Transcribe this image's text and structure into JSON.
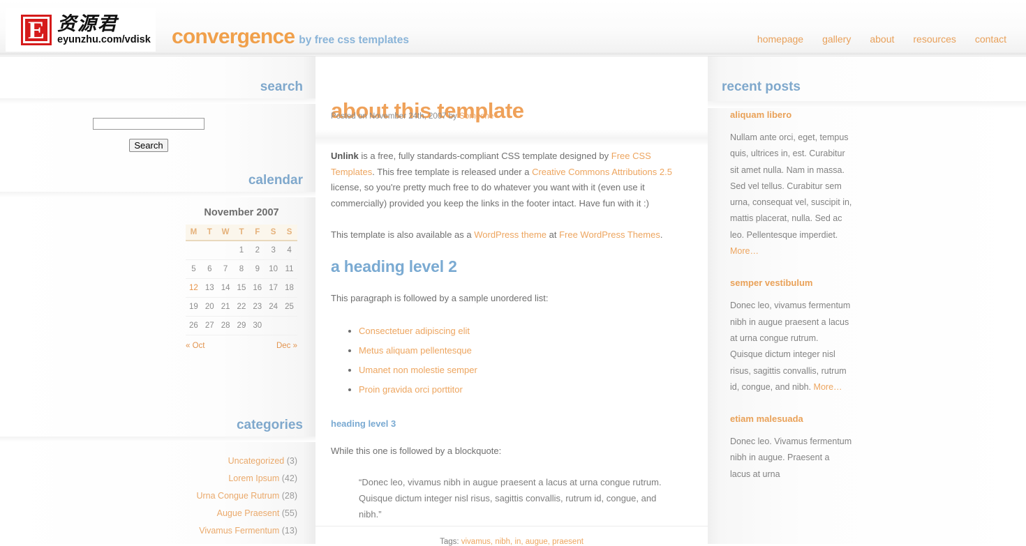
{
  "header": {
    "logo": {
      "badge_letter": "E",
      "chinese": "资源君",
      "url": "eyunzhu.com/vdisk"
    },
    "brand_name": "convergence",
    "brand_tagline": "by free css templates",
    "nav": [
      {
        "label": "homepage"
      },
      {
        "label": "gallery"
      },
      {
        "label": "about"
      },
      {
        "label": "resources"
      },
      {
        "label": "contact"
      }
    ]
  },
  "left_sidebar": {
    "search": {
      "heading": "search",
      "input_value": "",
      "placeholder": "",
      "button_label": "Search"
    },
    "calendar": {
      "heading": "calendar",
      "caption": "November 2007",
      "day_headers": [
        "M",
        "T",
        "W",
        "T",
        "F",
        "S",
        "S"
      ],
      "weeks": [
        [
          "",
          "",
          "",
          "1",
          "2",
          "3",
          "4"
        ],
        [
          "5",
          "6",
          "7",
          "8",
          "9",
          "10",
          "11"
        ],
        [
          "12",
          "13",
          "14",
          "15",
          "16",
          "17",
          "18"
        ],
        [
          "19",
          "20",
          "21",
          "22",
          "23",
          "24",
          "25"
        ],
        [
          "26",
          "27",
          "28",
          "29",
          "30",
          "",
          ""
        ]
      ],
      "today": "12",
      "prev_label": "« Oct",
      "next_label": "Dec »"
    },
    "categories": {
      "heading": "categories",
      "items": [
        {
          "label": "Uncategorized",
          "count": "(3)"
        },
        {
          "label": "Lorem Ipsum",
          "count": "(42)"
        },
        {
          "label": "Urna Congue Rutrum",
          "count": "(28)"
        },
        {
          "label": "Augue Praesent",
          "count": "(55)"
        },
        {
          "label": "Vivamus Fermentum",
          "count": "(13)"
        }
      ]
    }
  },
  "main": {
    "title": "about this template",
    "meta_prefix": "Posted on November 24th, 2007 by ",
    "meta_author": "Someone",
    "p1": {
      "lead": "Unlink",
      "t1": " is a free, fully standards-compliant CSS template designed by ",
      "link1": "Free CSS Templates",
      "t2": ". This free template is released under a ",
      "link2": "Creative Commons Attributions 2.5",
      "t3": " license, so you're pretty much free to do whatever you want with it (even use it commercially) provided you keep the links in the footer intact. Have fun with it :)"
    },
    "p2": {
      "t1": "This template is also available as a ",
      "link1": "WordPress theme",
      "t2": " at ",
      "link2": "Free WordPress Themes",
      "t3": "."
    },
    "h2": "a heading level 2",
    "p3": "This paragraph is followed by a sample unordered list:",
    "list": [
      "Consectetuer adipiscing elit",
      "Metus aliquam pellentesque",
      "Umanet non molestie semper",
      "Proin gravida orci porttitor"
    ],
    "h3": "heading level 3",
    "p4": "While this one is followed by a blockquote:",
    "blockquote": "“Donec leo, vivamus nibh in augue praesent a lacus at urna congue rutrum. Quisque dictum integer nisl risus, sagittis convallis, rutrum id, congue, and nibh.”",
    "tags_label": "Tags: ",
    "tags_links": "vivamus, nibh, in, augue, praesent"
  },
  "right_sidebar": {
    "heading": "recent posts",
    "posts": [
      {
        "title": "aliquam libero",
        "body": "Nullam ante orci, eget, tempus quis, ultrices in, est. Curabitur sit amet nulla. Nam in massa. Sed vel tellus. Curabitur sem urna, consequat vel, suscipit in, mattis placerat, nulla. Sed ac leo. Pellentesque imperdiet. ",
        "more": "More…"
      },
      {
        "title": "semper vestibulum",
        "body": "Donec leo, vivamus fermentum nibh in augue praesent a lacus at urna congue rutrum. Quisque dictum integer nisl risus, sagittis convallis, rutrum id, congue, and nibh. ",
        "more": "More…"
      },
      {
        "title": "etiam malesuada",
        "body": "Donec leo. Vivamus fermentum nibh in augue. Praesent a lacus at urna",
        "more": ""
      }
    ]
  },
  "colors": {
    "accent_orange": "#efa159",
    "accent_blue": "#7aaad2",
    "link_orange": "#eda55f",
    "logo_red": "#d51b1b",
    "text_gray": "#6f6f6f"
  }
}
